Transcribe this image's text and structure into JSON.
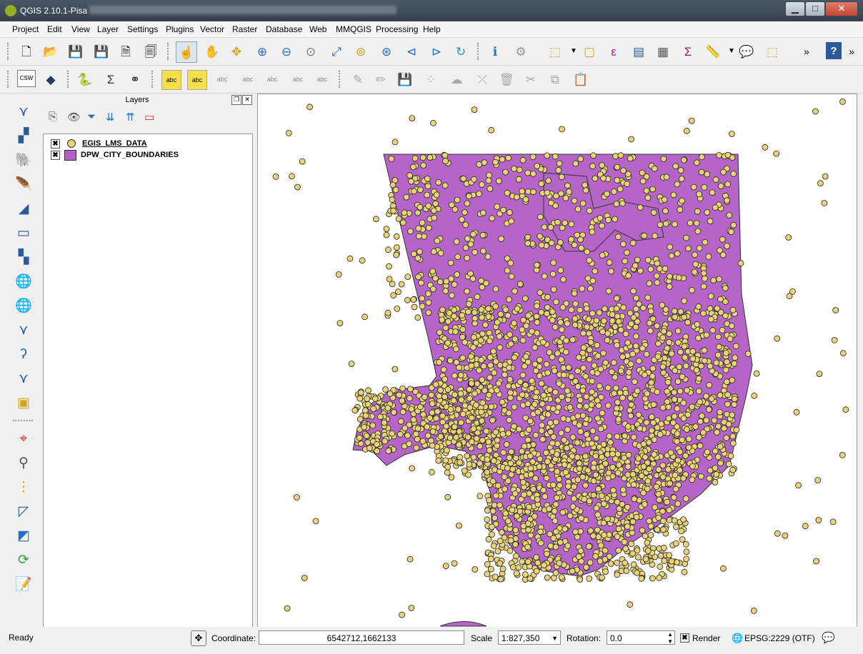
{
  "window": {
    "title": "QGIS 2.10.1-Pisa",
    "minimize": "▁",
    "maximize": "□",
    "close": "✕"
  },
  "menu": [
    "Project",
    "Edit",
    "View",
    "Layer",
    "Settings",
    "Plugins",
    "Vector",
    "Raster",
    "Database",
    "Web",
    "MMQGIS",
    "Processing",
    "Help"
  ],
  "toolbar1": {
    "icons": [
      "new-project-icon",
      "open-project-icon",
      "save-project-icon",
      "save-as-icon",
      "new-print-composer-icon",
      "composer-manager-icon",
      "touch-zoom-icon",
      "pan-icon",
      "pan-to-selection-icon",
      "zoom-in-icon",
      "zoom-out-icon",
      "zoom-native-icon",
      "zoom-full-icon",
      "zoom-to-selection-icon",
      "zoom-to-layer-icon",
      "zoom-last-icon",
      "zoom-next-icon",
      "refresh-icon",
      "identify-icon",
      "gear-icon",
      "select-features-icon",
      "deselect-icon",
      "expression-select-icon",
      "attribute-table-icon",
      "field-calculator-icon",
      "statistics-icon",
      "measure-icon",
      "annotation-icon",
      "add-feature-icon"
    ],
    "overflow": "»",
    "help": "?"
  },
  "toolbar2": {
    "csw": "CSW",
    "abc": "abc"
  },
  "layers_panel": {
    "title": "Layers",
    "layers": [
      {
        "name": "EGIS_LMS_DATA",
        "checked": "✖",
        "symbol_color": "#e8d27a"
      },
      {
        "name": "DPW_CITY_BOUNDARIES",
        "checked": "✖",
        "symbol_color": "#b55fc6"
      }
    ]
  },
  "map": {
    "polygon_color": "#b565c7",
    "point_color": "#e8d27a"
  },
  "status": {
    "ready": "Ready",
    "coordinate_label": "Coordinate:",
    "coordinate_value": "6542712,1662133",
    "scale_label": "Scale",
    "scale_value": "1:827,350",
    "rotation_label": "Rotation:",
    "rotation_value": "0.0",
    "render_label": "Render",
    "render_checked": "✖",
    "crs": "EPSG:2229 (OTF)"
  }
}
